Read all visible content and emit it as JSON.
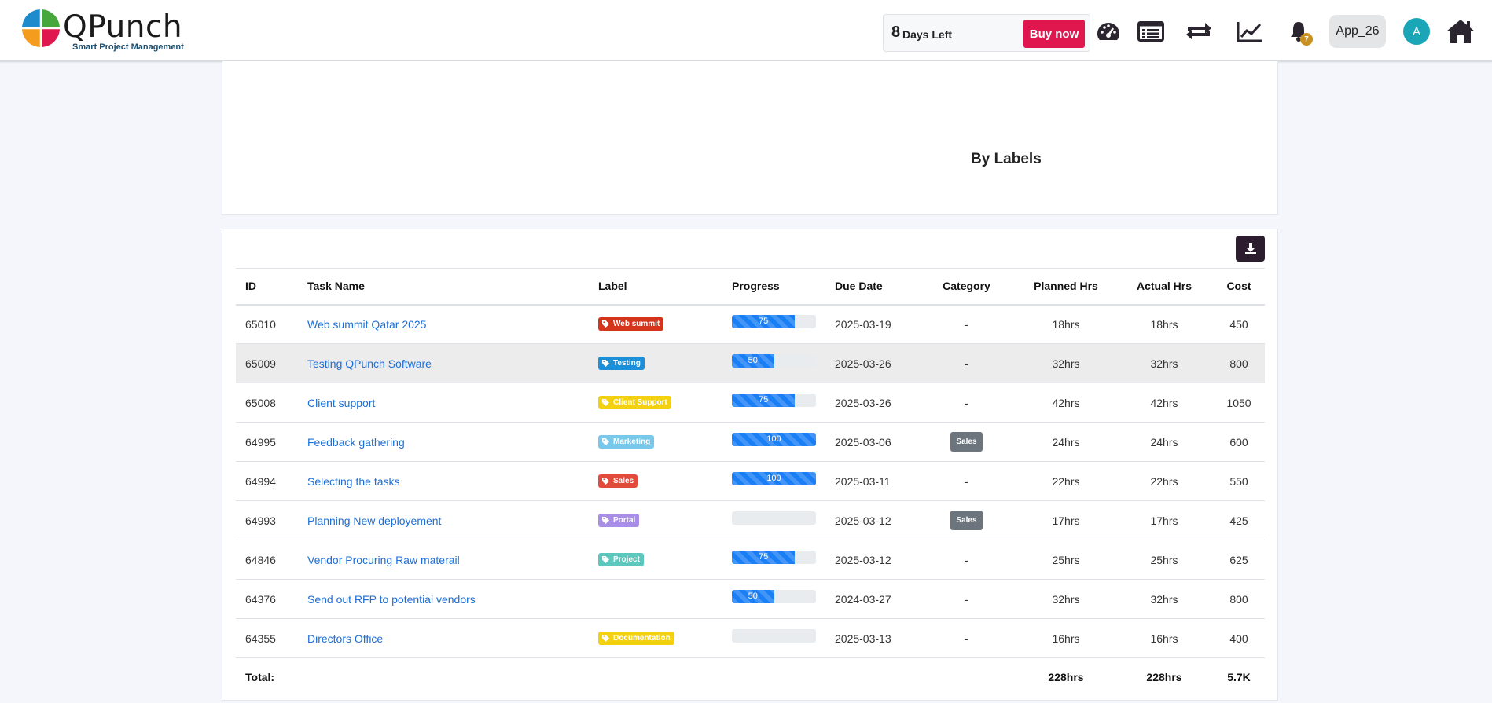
{
  "header": {
    "brand": "QPunch",
    "tagline": "Smart Project Management",
    "trial_days": "8",
    "trial_label": "Days Left",
    "buy_label": "Buy now",
    "notification_count": "7",
    "workspace": "App_26",
    "avatar_initial": "A"
  },
  "chart_panel": {
    "title": "By Labels"
  },
  "table": {
    "columns": {
      "id": "ID",
      "task": "Task Name",
      "label": "Label",
      "progress": "Progress",
      "due": "Due Date",
      "category": "Category",
      "planned": "Planned Hrs",
      "actual": "Actual Hrs",
      "cost": "Cost"
    },
    "rows": [
      {
        "id": "65010",
        "task": "Web summit Qatar 2025",
        "label": "Web summit",
        "label_color": "#d4341a",
        "progress": 75,
        "progress_text": "75",
        "due": "2025-03-19",
        "category": "-",
        "planned": "18hrs",
        "actual": "18hrs",
        "cost": "450"
      },
      {
        "id": "65009",
        "task": "Testing QPunch Software",
        "label": "Testing",
        "label_color": "#1b8fd8",
        "progress": 50,
        "progress_text": "50",
        "due": "2025-03-26",
        "category": "-",
        "planned": "32hrs",
        "actual": "32hrs",
        "cost": "800"
      },
      {
        "id": "65008",
        "task": "Client support",
        "label": "Client Support",
        "label_color": "#f3d110",
        "progress": 75,
        "progress_text": "75",
        "due": "2025-03-26",
        "category": "-",
        "planned": "42hrs",
        "actual": "42hrs",
        "cost": "1050"
      },
      {
        "id": "64995",
        "task": "Feedback gathering",
        "label": "Marketing",
        "label_color": "#78c8ec",
        "progress": 100,
        "progress_text": "100",
        "due": "2025-03-06",
        "category": "Sales",
        "planned": "24hrs",
        "actual": "24hrs",
        "cost": "600"
      },
      {
        "id": "64994",
        "task": "Selecting the tasks",
        "label": "Sales",
        "label_color": "#e24b3c",
        "progress": 100,
        "progress_text": "100",
        "due": "2025-03-11",
        "category": "-",
        "planned": "22hrs",
        "actual": "22hrs",
        "cost": "550"
      },
      {
        "id": "64993",
        "task": "Planning New deployement",
        "label": "Portal",
        "label_color": "#a98ee8",
        "progress": 0,
        "progress_text": "",
        "due": "2025-03-12",
        "category": "Sales",
        "planned": "17hrs",
        "actual": "17hrs",
        "cost": "425"
      },
      {
        "id": "64846",
        "task": "Vendor Procuring Raw materail",
        "label": "Project",
        "label_color": "#5cc7bc",
        "progress": 75,
        "progress_text": "75",
        "due": "2025-03-12",
        "category": "-",
        "planned": "25hrs",
        "actual": "25hrs",
        "cost": "625"
      },
      {
        "id": "64376",
        "task": "Send out RFP to potential vendors",
        "label": "",
        "label_color": "",
        "progress": 50,
        "progress_text": "50",
        "due": "2024-03-27",
        "category": "-",
        "planned": "32hrs",
        "actual": "32hrs",
        "cost": "800"
      },
      {
        "id": "64355",
        "task": "Directors Office",
        "label": "Documentation",
        "label_color": "#f3d110",
        "progress": 0,
        "progress_text": "",
        "due": "2025-03-13",
        "category": "-",
        "planned": "16hrs",
        "actual": "16hrs",
        "cost": "400"
      }
    ],
    "totals": {
      "label": "Total:",
      "planned": "228hrs",
      "actual": "228hrs",
      "cost": "5.7K"
    }
  }
}
